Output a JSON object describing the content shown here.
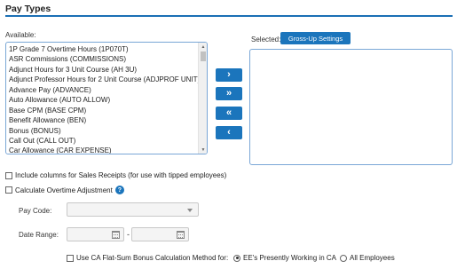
{
  "section": {
    "title": "Pay Types"
  },
  "available": {
    "label": "Available:",
    "items": [
      "1P Grade 7 Overtime Hours (1P070T)",
      "ASR Commissions (COMMISSIONS)",
      "Adjunct Hours for 3 Unit Course (AH 3U)",
      "Adjunct Professor Hours for 2 Unit Course (ADJPROF UNIT)",
      "Advance Pay (ADVANCE)",
      "Auto Allowance (AUTO ALLOW)",
      "Base CPM (BASE CPM)",
      "Benefit Allowance (BEN)",
      "Bonus (BONUS)",
      "Call Out (CALL OUT)",
      "Car Allowance (CAR EXPENSE)"
    ]
  },
  "selected": {
    "label": "Selected:",
    "gross_up_button": "Gross-Up Settings"
  },
  "move_buttons": {
    "add_one": "›",
    "add_all": "»",
    "remove_all": "«",
    "remove_one": "‹"
  },
  "options": {
    "sales_receipts": "Include columns for Sales Receipts (for use with tipped employees)",
    "overtime_adjustment": "Calculate Overtime Adjustment"
  },
  "pay_code": {
    "label": "Pay Code:",
    "value": ""
  },
  "date_range": {
    "label": "Date Range:",
    "from": "",
    "to": "",
    "separator": "-"
  },
  "ca_bonus": {
    "label": "Use CA Flat-Sum Bonus Calculation Method for:",
    "option_working": "EE's Presently Working in CA",
    "option_all": "All Employees",
    "selected": "EE's Presently Working in CA"
  },
  "colors": {
    "accent": "#1b75bc",
    "rule": "#1b6fb5",
    "list_border": "#7aa7d6"
  }
}
